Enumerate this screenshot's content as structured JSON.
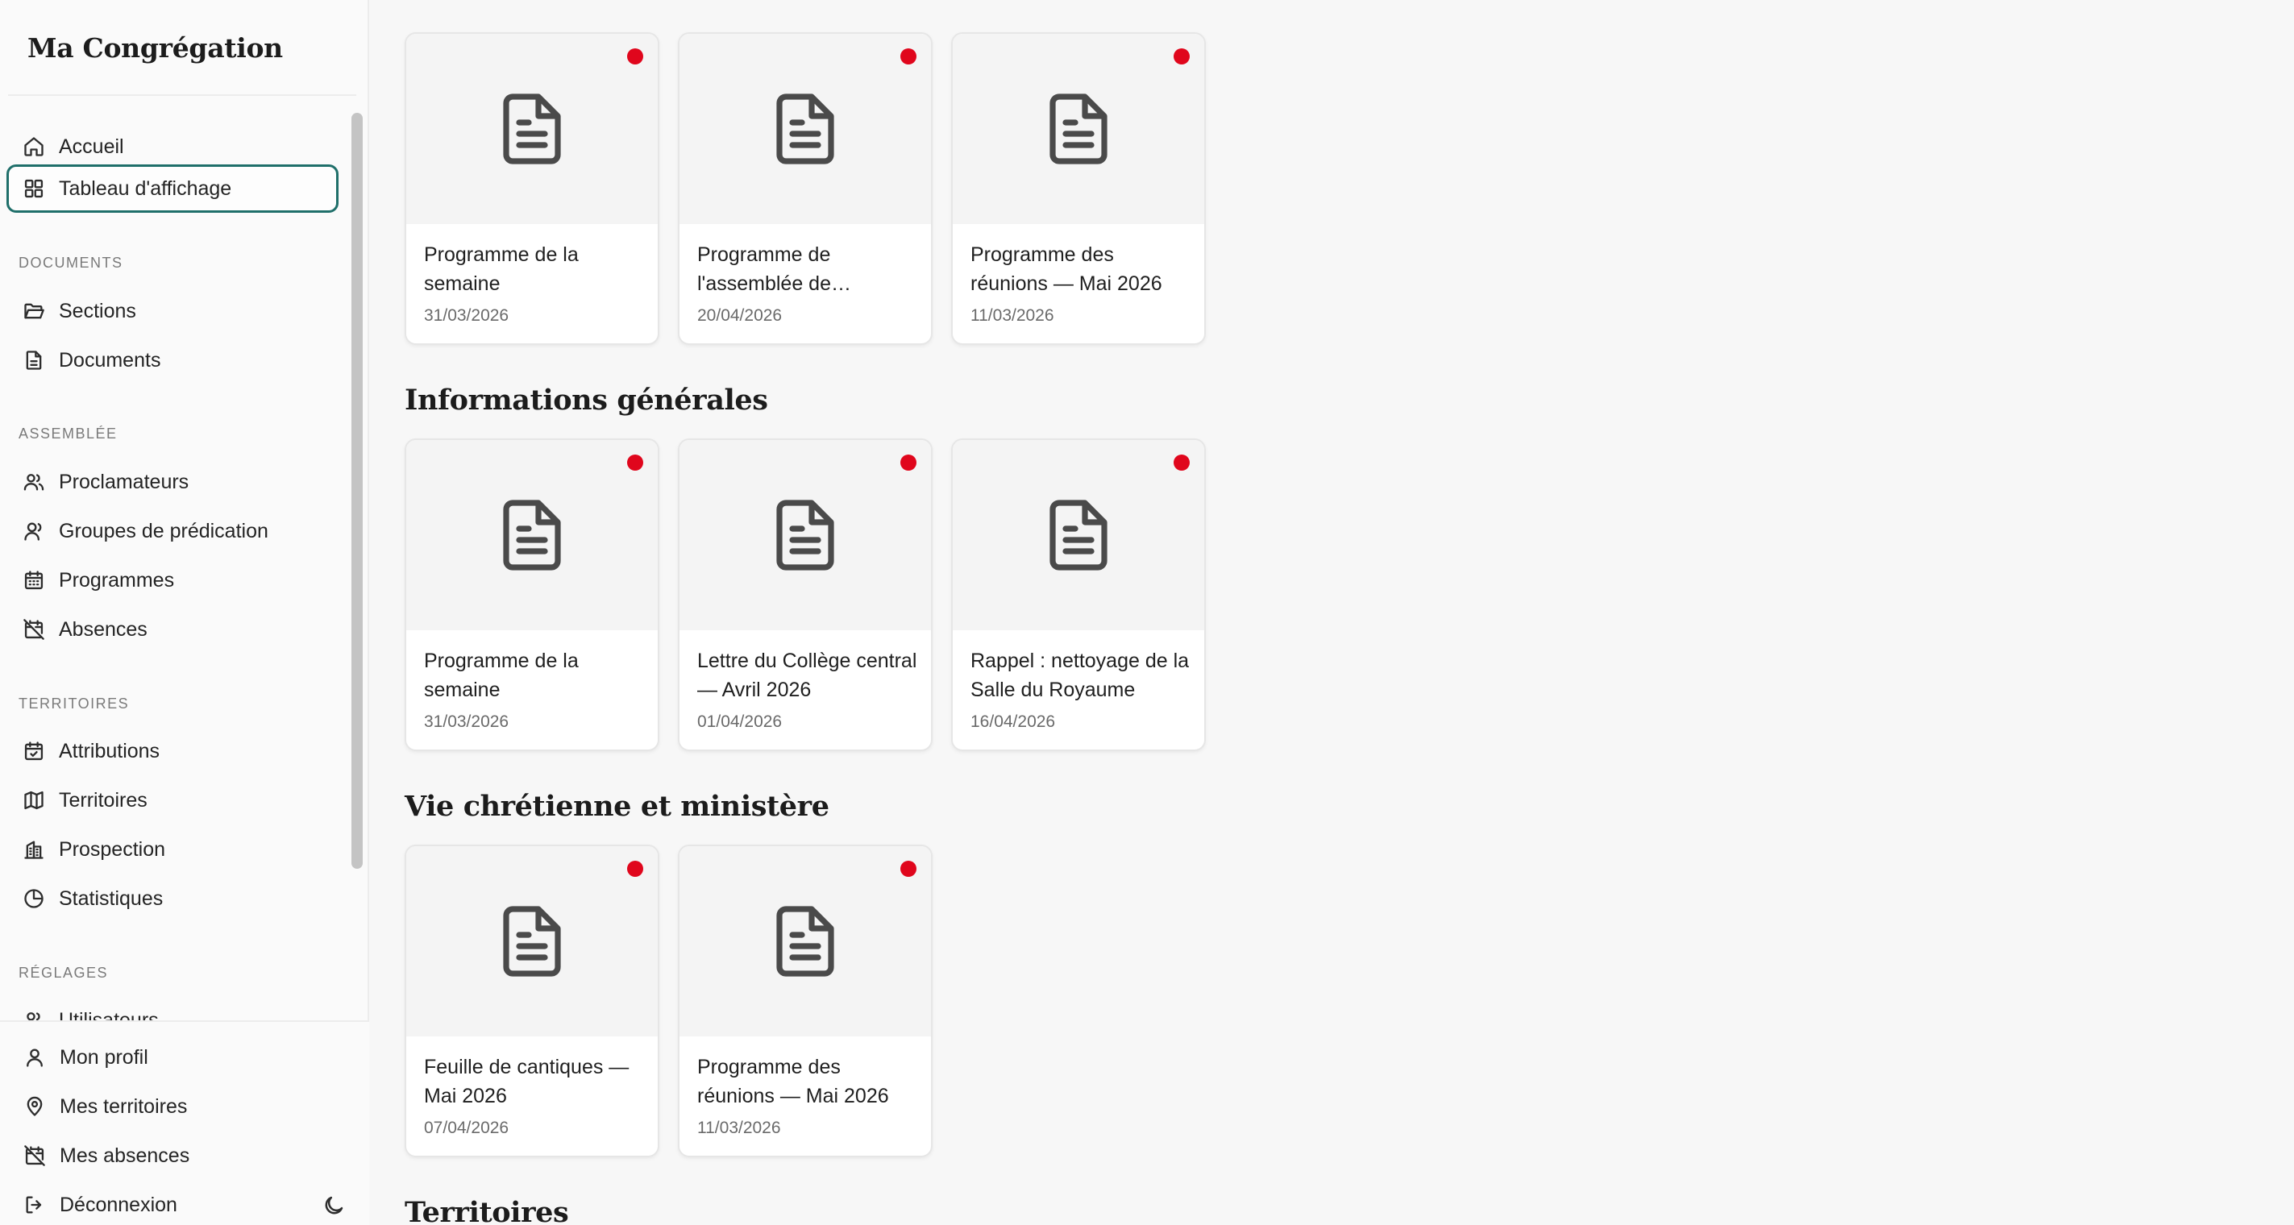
{
  "app": {
    "name": "Ma Congrégation"
  },
  "colors": {
    "accent": "#1f6f6a",
    "badge": "#e0061c"
  },
  "sidebar": {
    "top_items": [
      {
        "label": "Accueil",
        "icon": "home-icon"
      },
      {
        "label": "Tableau d'affichage",
        "icon": "grid-icon",
        "active": true
      }
    ],
    "sections": [
      {
        "title": "DOCUMENTS",
        "items": [
          {
            "label": "Sections",
            "icon": "folder-open-icon"
          },
          {
            "label": "Documents",
            "icon": "file-icon"
          }
        ]
      },
      {
        "title": "ASSEMBLÉE",
        "items": [
          {
            "label": "Proclamateurs",
            "icon": "users-icon"
          },
          {
            "label": "Groupes de prédication",
            "icon": "user-group-icon"
          },
          {
            "label": "Programmes",
            "icon": "calendar-grid-icon"
          },
          {
            "label": "Absences",
            "icon": "calendar-off-icon"
          }
        ]
      },
      {
        "title": "TERRITOIRES",
        "items": [
          {
            "label": "Attributions",
            "icon": "calendar-check-icon"
          },
          {
            "label": "Territoires",
            "icon": "map-icon"
          },
          {
            "label": "Prospection",
            "icon": "building-icon"
          },
          {
            "label": "Statistiques",
            "icon": "pie-chart-icon"
          }
        ]
      },
      {
        "title": "RÉGLAGES",
        "items": [
          {
            "label": "Utilisateurs",
            "icon": "users-icon"
          }
        ]
      }
    ],
    "bottom_items": [
      {
        "label": "Mon profil",
        "icon": "user-icon"
      },
      {
        "label": "Mes territoires",
        "icon": "map-pin-icon"
      },
      {
        "label": "Mes absences",
        "icon": "calendar-off-icon"
      },
      {
        "label": "Déconnexion",
        "icon": "logout-icon"
      }
    ],
    "theme_toggle_icon": "moon-icon"
  },
  "main": {
    "groups": [
      {
        "title": "",
        "cards": [
          {
            "title": "Programme de la semaine",
            "date": "31/03/2026"
          },
          {
            "title": "Programme de l'assemblée de…",
            "date": "20/04/2026"
          },
          {
            "title": "Programme des réunions — Mai 2026",
            "date": "11/03/2026"
          }
        ]
      },
      {
        "title": "Informations générales",
        "cards": [
          {
            "title": "Programme de la semaine",
            "date": "31/03/2026"
          },
          {
            "title": "Lettre du Collège central — Avril 2026",
            "date": "01/04/2026"
          },
          {
            "title": "Rappel : nettoyage de la Salle du Royaume",
            "date": "16/04/2026"
          }
        ]
      },
      {
        "title": "Vie chrétienne et ministère",
        "cards": [
          {
            "title": "Feuille de cantiques — Mai 2026",
            "date": "07/04/2026"
          },
          {
            "title": "Programme des réunions — Mai 2026",
            "date": "11/03/2026"
          }
        ]
      },
      {
        "title": "Territoires",
        "cards": []
      }
    ]
  }
}
